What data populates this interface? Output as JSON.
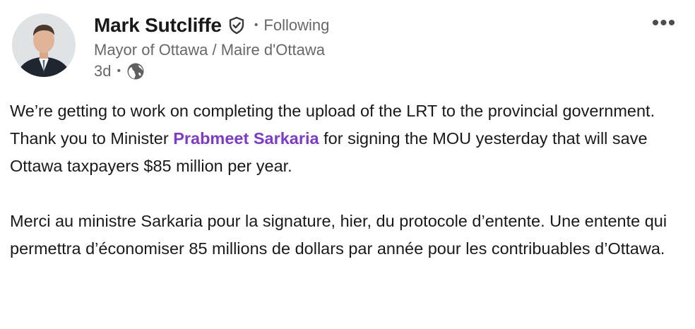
{
  "author": {
    "name": "Mark Sutcliffe",
    "headline": "Mayor of Ottawa / Maire d'Ottawa",
    "follow_status": "Following",
    "separator": "•",
    "verified_icon": "verified-shield-check-icon",
    "avatar": "profile-photo"
  },
  "meta": {
    "time": "3d",
    "separator": "•",
    "visibility_icon": "globe-icon"
  },
  "menu": {
    "more_label": "•••"
  },
  "post": {
    "p1_before": "We’re getting to work on completing the upload of the LRT to the provincial government. Thank you to Minister ",
    "mention": "Prabmeet Sarkaria",
    "p1_after": " for signing the MOU yesterday that will save Ottawa taxpayers $85 million per year.",
    "p2": "Merci au ministre Sarkaria pour la signature, hier, du protocole d’entente. Une entente qui permettra d’économiser 85 millions de dollars par année pour les contribuables d’Ottawa."
  },
  "colors": {
    "mention": "#7d3cc3",
    "text": "#1a1a1a",
    "muted": "#666666"
  }
}
